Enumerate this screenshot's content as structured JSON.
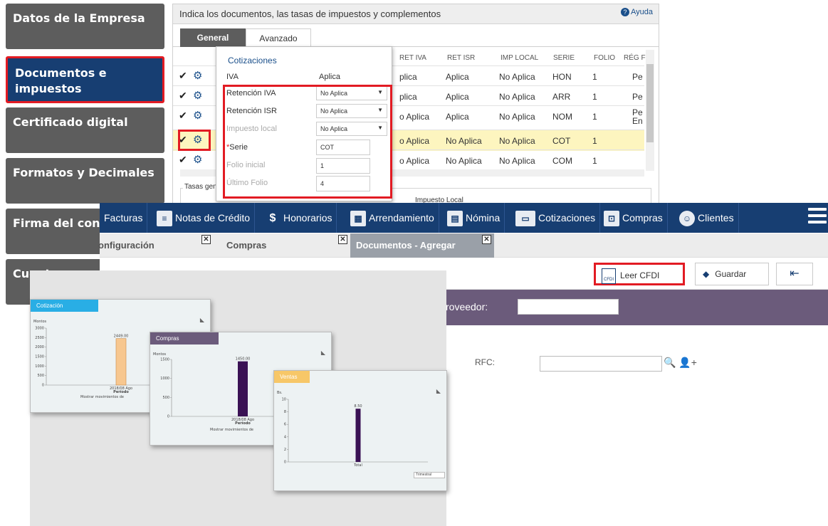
{
  "sidebar": {
    "items": [
      {
        "label": "Datos de la Empresa"
      },
      {
        "label": "Documentos e impuestos"
      },
      {
        "label": "Certificado digital"
      },
      {
        "label": "Formatos y Decimales"
      },
      {
        "label": "Firma del contra"
      },
      {
        "label": "Cuentas por cob"
      }
    ]
  },
  "panel": {
    "title": "Indica los documentos, las tasas de impuestos y complementos",
    "help": "Ayuda",
    "tabs": [
      "General",
      "Avanzado"
    ],
    "columns": [
      "RET IVA",
      "RET ISR",
      "IMP LOCAL",
      "SERIE",
      "FOLIO",
      "RÉG F"
    ],
    "rows": [
      {
        "ret_iva": "plica",
        "ret_isr": "Aplica",
        "imp_local": "No Aplica",
        "serie": "HON",
        "folio": "1",
        "reg": "Pe"
      },
      {
        "ret_iva": "plica",
        "ret_isr": "Aplica",
        "imp_local": "No Aplica",
        "serie": "ARR",
        "folio": "1",
        "reg": "Pe"
      },
      {
        "ret_iva": "o Aplica",
        "ret_isr": "Aplica",
        "imp_local": "No Aplica",
        "serie": "NOM",
        "folio": "1",
        "reg": "Pe En"
      },
      {
        "ret_iva": "o Aplica",
        "ret_isr": "No Aplica",
        "imp_local": "No Aplica",
        "serie": "COT",
        "folio": "1",
        "reg": ""
      },
      {
        "ret_iva": "o Aplica",
        "ret_isr": "No Aplica",
        "imp_local": "No Aplica",
        "serie": "COM",
        "folio": "1",
        "reg": ""
      }
    ],
    "tasas_label": "Tasas gen",
    "impuesto_local_label": "Impuesto Local"
  },
  "popup": {
    "title": "Cotizaciones",
    "iva_label": "IVA",
    "iva_value": "Aplica",
    "ret_iva_label": "Retención IVA",
    "ret_iva_value": "No Aplica",
    "ret_isr_label": "Retención ISR",
    "ret_isr_value": "No Aplica",
    "imp_local_label": "Impuesto local",
    "imp_local_value": "No Aplica",
    "serie_label": "Serie",
    "serie_value": "COT",
    "folio_inicial_label": "Folio inicial",
    "folio_inicial_value": "1",
    "ultimo_folio_label": "Último Folio",
    "ultimo_folio_value": "4"
  },
  "navbar": {
    "items": [
      "Facturas",
      "Notas de Crédito",
      "Honorarios",
      "Arrendamiento",
      "Nómina",
      "Cotizaciones",
      "Compras",
      "Clientes"
    ]
  },
  "doc_tabs": [
    "onfiguración",
    "Compras",
    "Documentos - Agregar"
  ],
  "toolbar": {
    "leer": "Leer CFDI",
    "cfdi_icon": "CFDI",
    "guardar": "Guardar"
  },
  "form": {
    "proveedor_label": "roveedor:",
    "rfc_label": "RFC:"
  },
  "charts": {
    "cotizacion_tab": "Cotización",
    "compras_tab": "Compras",
    "third_tab": "Ventas",
    "y_label": "Montos",
    "x_label": "Período",
    "footer": "Mostrar movimientos de",
    "combo": "Trimestral"
  },
  "chart_data": [
    {
      "type": "bar",
      "title": "Cotización",
      "categories": [
        "2018/08 Ago"
      ],
      "values": [
        2449
      ],
      "ylabel": "Montos",
      "ylim": [
        0,
        3000
      ],
      "yticks": [
        0,
        500,
        1000,
        1500,
        2000,
        2500,
        3000
      ],
      "bar_color": "#f7c78f",
      "value_label": "2449.00"
    },
    {
      "type": "bar",
      "title": "Compras",
      "categories": [
        "2018/08 Ago"
      ],
      "values": [
        1450
      ],
      "ylabel": "Montos",
      "ylim": [
        0,
        1500
      ],
      "yticks": [
        0,
        500,
        1000,
        1500
      ],
      "bar_color": "#3a1254",
      "value_label": "1450.00"
    },
    {
      "type": "bar",
      "title": "",
      "categories": [
        "Total"
      ],
      "values": [
        8.5
      ],
      "ylabel": "Bs.",
      "ylim": [
        0,
        10
      ],
      "yticks": [
        0,
        2,
        4,
        6,
        8,
        10
      ],
      "bar_color": "#3a1254",
      "value_label": "8.50"
    }
  ]
}
